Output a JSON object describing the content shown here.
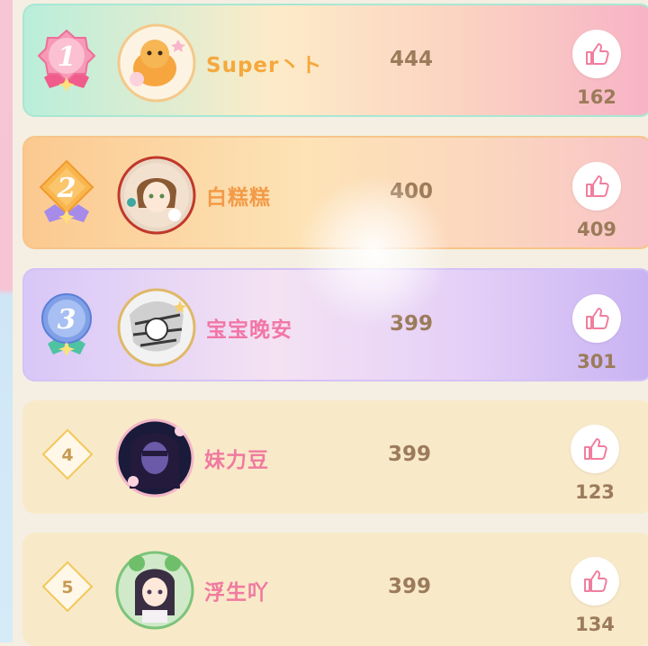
{
  "colors": {
    "score_text": "#9b7b5a",
    "name_rank1": "#f5a83c",
    "name_rank2": "#f29a47",
    "name_rank3": "#f276a6",
    "name_default": "#f07aa0",
    "like_icon": "#f07e9e"
  },
  "ranking": [
    {
      "rank": "1",
      "name": "Super丶ト",
      "score": "444",
      "likes": "162",
      "avatar": "cat-plush-avatar-icon"
    },
    {
      "rank": "2",
      "name": "白糕糕",
      "score": "400",
      "likes": "409",
      "avatar": "anime-girl-avatar-icon"
    },
    {
      "rank": "3",
      "name": "宝宝晚安",
      "score": "399",
      "likes": "301",
      "avatar": "manga-sketch-avatar-icon"
    },
    {
      "rank": "4",
      "name": "妹力豆",
      "score": "399",
      "likes": "123",
      "avatar": "dark-hair-girl-avatar-icon"
    },
    {
      "rank": "5",
      "name": "浮生吖",
      "score": "399",
      "likes": "134",
      "avatar": "frog-hat-girl-avatar-icon"
    }
  ]
}
